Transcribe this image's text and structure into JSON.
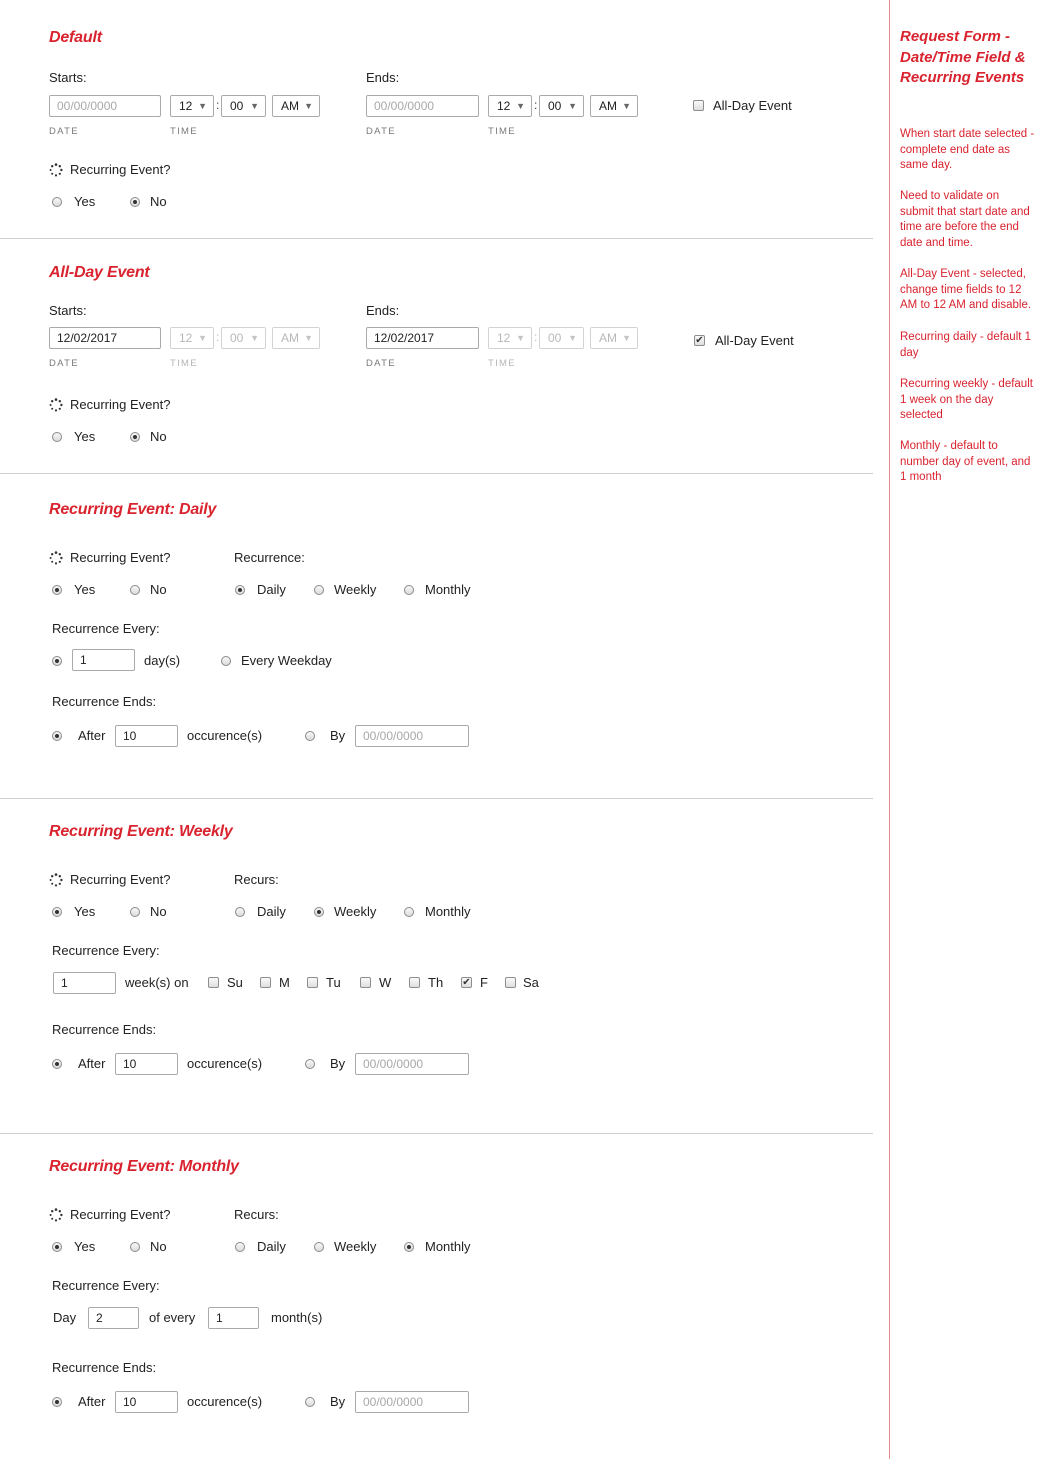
{
  "sidebar": {
    "title_lines": [
      "Request Form -",
      "Date/Time Field &",
      "Recurring Events"
    ],
    "notes": [
      [
        "When start date selected -",
        "complete end date as",
        "same day."
      ],
      [
        "Need to validate on",
        "submit that start date and",
        "time are before the end",
        "date and time."
      ],
      [
        "All-Day Event - selected,",
        "change time fields to 12",
        "AM to 12 AM and disable."
      ],
      [
        "Recurring daily - default 1",
        "day"
      ],
      [
        "Recurring weekly - default",
        "1 week on the day",
        "selected"
      ],
      [
        "Monthly - default to",
        "number day of event, and",
        "1 month"
      ]
    ]
  },
  "common": {
    "starts": "Starts:",
    "ends": "Ends:",
    "date_cap": "DATE",
    "time_cap": "TIME",
    "hour": "12",
    "minute": "00",
    "ampm": "AM",
    "colon": ":",
    "date_placeholder": "00/00/0000",
    "all_day_label": "All-Day Event",
    "recurring_q": "Recurring Event?",
    "yes": "Yes",
    "no": "No",
    "daily": "Daily",
    "weekly": "Weekly",
    "monthly": "Monthly",
    "recurrence_every": "Recurrence Every:",
    "recurrence_ends": "Recurrence Ends:",
    "after": "After",
    "occurences": "occurence(s)",
    "by": "By",
    "after_value": "10"
  },
  "default_section": {
    "title": "Default",
    "all_day_checked": false,
    "recurring": "no"
  },
  "allday_section": {
    "title": "All-Day Event",
    "start_date": "12/02/2017",
    "end_date": "12/02/2017",
    "all_day_checked": true,
    "recurring": "no"
  },
  "daily_section": {
    "title": "Recurring Event: Daily",
    "recurrence_label": "Recurrence:",
    "every_value": "1",
    "days_label": "day(s)",
    "every_weekday": "Every Weekday"
  },
  "weekly_section": {
    "title": "Recurring Event: Weekly",
    "recurs_label": "Recurs:",
    "every_value": "1",
    "weeks_on": "week(s) on",
    "days": [
      {
        "label": "Su",
        "checked": false
      },
      {
        "label": "M",
        "checked": false
      },
      {
        "label": "Tu",
        "checked": false
      },
      {
        "label": "W",
        "checked": false
      },
      {
        "label": "Th",
        "checked": false
      },
      {
        "label": "F",
        "checked": true
      },
      {
        "label": "Sa",
        "checked": false
      }
    ]
  },
  "monthly_section": {
    "title": "Recurring Event: Monthly",
    "recurs_label": "Recurs:",
    "day_label": "Day",
    "day_value": "2",
    "of_every": "of every",
    "month_value": "1",
    "months_label": "month(s)"
  }
}
